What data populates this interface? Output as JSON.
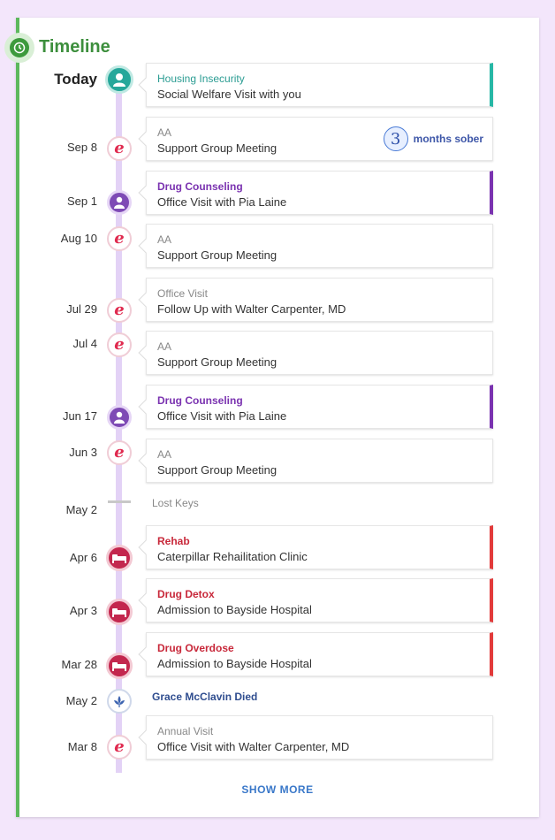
{
  "header": {
    "title": "Timeline",
    "icon": "clock-icon"
  },
  "today_event": {
    "date": "Today",
    "category": "Housing Insecurity",
    "description": "Social Welfare Visit with you",
    "icon": "social-worker-icon"
  },
  "events": [
    {
      "date": "Sep 8",
      "category": "AA",
      "description": "Support Group Meeting",
      "icon": "e-logo-icon",
      "badge_number": "3",
      "badge_label": "months sober"
    },
    {
      "date": "Sep 1",
      "category": "Drug Counseling",
      "description": "Office Visit with Pia Laine",
      "icon": "counselor-icon"
    },
    {
      "date": "Aug 10",
      "category": "AA",
      "description": "Support Group Meeting",
      "icon": "e-logo-icon"
    },
    {
      "date": "Jul 29",
      "category": "Office Visit",
      "description": "Follow Up with Walter Carpenter, MD",
      "icon": "e-logo-icon"
    },
    {
      "date": "Jul 4",
      "category": "AA",
      "description": "Support Group Meeting",
      "icon": "e-logo-icon"
    },
    {
      "date": "Jun 17",
      "category": "Drug Counseling",
      "description": "Office Visit with Pia Laine",
      "icon": "counselor-icon"
    },
    {
      "date": "Jun 3",
      "category": "AA",
      "description": "Support Group Meeting",
      "icon": "e-logo-icon"
    },
    {
      "date": "May 2",
      "label": "Lost Keys"
    },
    {
      "date": "Apr 6",
      "category": "Rehab",
      "description": "Caterpillar Rehailitation Clinic",
      "icon": "hospital-bed-icon"
    },
    {
      "date": "Apr 3",
      "category": "Drug Detox",
      "description": "Admission to Bayside Hospital",
      "icon": "hospital-bed-icon"
    },
    {
      "date": "Mar 28",
      "category": "Drug Overdose",
      "description": "Admission to Bayside Hospital",
      "icon": "hospital-bed-icon"
    },
    {
      "date": "May 2",
      "label": "Grace McClavin Died",
      "icon": "lotus-icon"
    },
    {
      "date": "Mar 8",
      "category": "Annual Visit",
      "description": "Office Visit with Walter Carpenter, MD",
      "icon": "e-logo-icon"
    }
  ],
  "footer": {
    "show_more": "SHOW MORE"
  },
  "colors": {
    "background": "#f3e6fb",
    "accent_green": "#5cb85c",
    "teal": "#26b7a5",
    "purple": "#7a32b0",
    "red": "#e23a3a",
    "rail": "#e3d2f6"
  }
}
